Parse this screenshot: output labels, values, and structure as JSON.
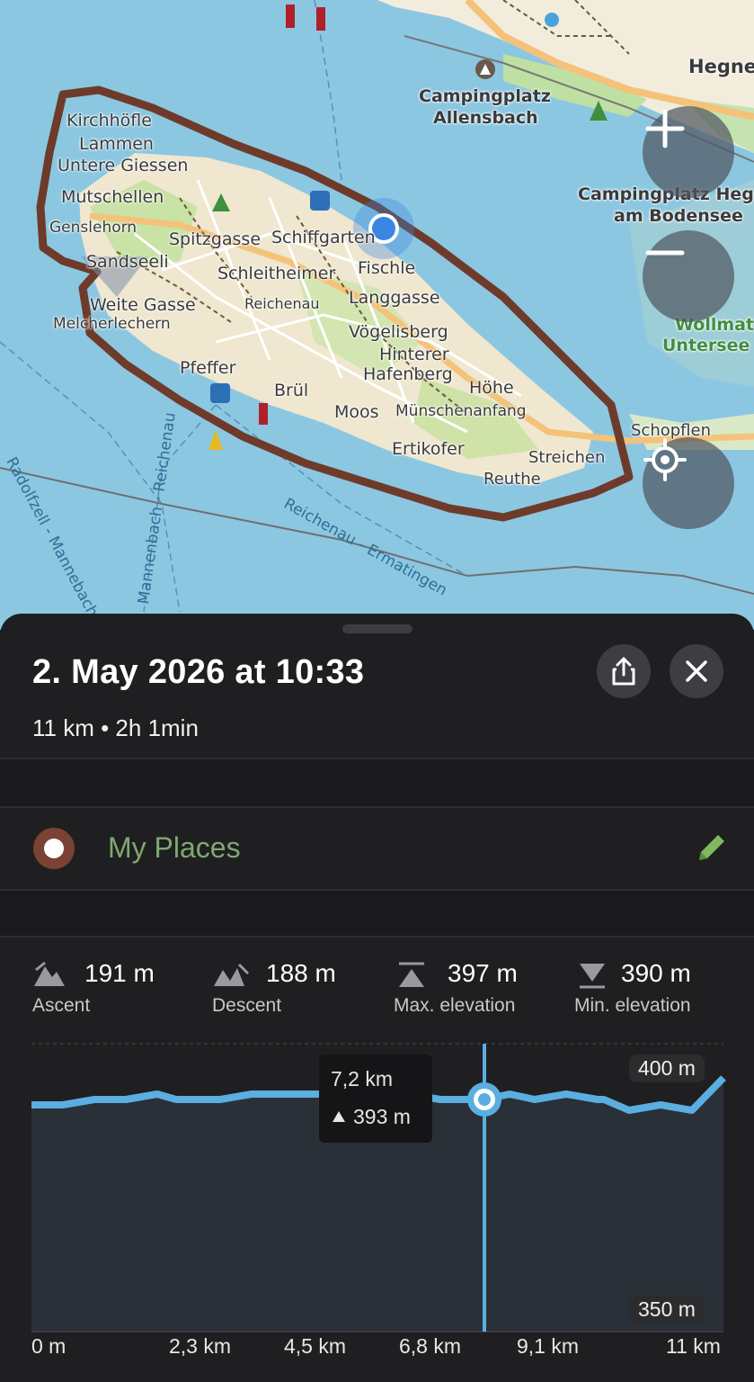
{
  "map": {
    "labels": {
      "hegne": "Hegne",
      "camping_allensbach_1": "Campingplatz",
      "camping_allensbach_2": "Allensbach",
      "camping_hegne_1": "Campingplatz Hegne",
      "camping_hegne_2": "am Bodensee",
      "wollmatinger_1": "Wollmati",
      "wollmatinger_2": "Untersee -",
      "kirchhofle": "Kirchhöfle",
      "lammen": "Lammen",
      "untere_giessen": "Untere Giessen",
      "mutschellen": "Mutschellen",
      "genslehorn": "Genslehorn",
      "sandseeli": "Sandseeli",
      "weite_gasse": "Weite Gasse",
      "melcherlechern": "Melcherlechern",
      "pfeffer": "Pfeffer",
      "brul": "Brül",
      "spitzgasse": "Spitzgasse",
      "schiffgarten": "Schiffgarten",
      "schleitheimer": "Schleitheimer",
      "reichenau": "Reichenau",
      "fischle": "Fischle",
      "langgasse": "Langgasse",
      "vogelisberg": "Vögelisberg",
      "hintere_hafenberg": "Hafenberg",
      "hinterer": "Hinterer",
      "hohe": "Höhe",
      "moos": "Moos",
      "munschenanfang": "Münschenanfang",
      "ertikofer": "Ertikofer",
      "reuthe": "Reuthe",
      "streichen": "Streichen",
      "schopflen": "Schopflen",
      "ferry_radolfzell": "Radolfzell - Mannebach",
      "ferry_mannenbach": "Mannenbach - Reichenau",
      "ferry_ermatingen": "Reichenau - Ermatingen"
    },
    "icons": {
      "zoom_in": "plus-icon",
      "zoom_out": "minus-icon",
      "locate": "crosshair-icon"
    }
  },
  "sheet": {
    "title": "2. May 2026 at 10:33",
    "summary": "11 km • 2h 1min",
    "share_icon": "share-icon",
    "close_icon": "close-icon",
    "list_name": "My Places",
    "list_color": "#7a4232",
    "edit_icon": "pencil-icon"
  },
  "stats": {
    "ascent": {
      "value": "191 m",
      "label": "Ascent"
    },
    "descent": {
      "value": "188 m",
      "label": "Descent"
    },
    "max_elevation": {
      "value": "397 m",
      "label": "Max. elevation"
    },
    "min_elevation": {
      "value": "390 m",
      "label": "Min. elevation"
    }
  },
  "chart_data": {
    "type": "area",
    "x_unit": "km",
    "y_unit": "m",
    "xlim": [
      0,
      11
    ],
    "ylim": [
      350,
      400
    ],
    "x_tick_labels": [
      "0 m",
      "2,3 km",
      "4,5 km",
      "6,8 km",
      "9,1 km",
      "11 km"
    ],
    "y_tick_labels": [
      "400 m",
      "350 m"
    ],
    "series": [
      {
        "x": [
          0,
          0.5,
          1,
          1.5,
          2,
          2.3,
          2.6,
          3,
          3.5,
          4,
          4.5,
          5,
          5.5,
          6,
          6.5,
          6.8,
          7.2,
          7.6,
          8,
          8.5,
          9,
          9.1,
          9.5,
          10,
          10.5,
          11
        ],
        "y": [
          392,
          392,
          393,
          393,
          394,
          393,
          393,
          393,
          394,
          394,
          394,
          394,
          394,
          394,
          393,
          393,
          393,
          394,
          393,
          394,
          393,
          393,
          391,
          392,
          391,
          397
        ]
      }
    ],
    "cursor": {
      "x_label": "7,2 km",
      "y_label": "393 m",
      "x": 7.2,
      "y": 393
    },
    "color": "#5aaee0"
  }
}
